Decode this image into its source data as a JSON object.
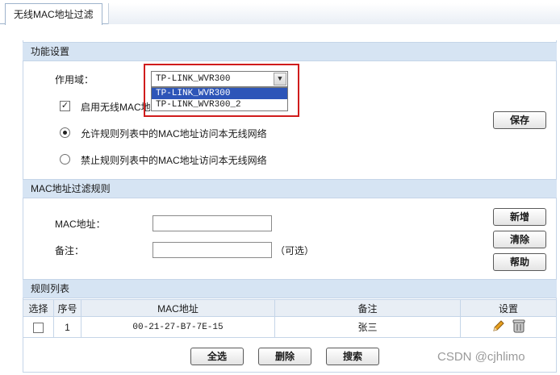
{
  "tab": {
    "title": "无线MAC地址过滤"
  },
  "function_settings": {
    "header": "功能设置",
    "scope_label": "作用域：",
    "scope_selected": "TP-LINK_WVR300",
    "scope_options": [
      "TP-LINK_WVR300",
      "TP-LINK_WVR300_2"
    ],
    "enable_label": "启用无线MAC地址过滤",
    "enable_checked": true,
    "allow_label": "允许规则列表中的MAC地址访问本无线网络",
    "deny_label": "禁止规则列表中的MAC地址访问本无线网络",
    "selected_mode": "allow",
    "save_label": "保存"
  },
  "filter_rules": {
    "header": "MAC地址过滤规则",
    "mac_label": "MAC地址：",
    "mac_value": "",
    "note_label": "备注：",
    "note_value": "",
    "optional_hint": "（可选）",
    "add_label": "新增",
    "clear_label": "清除",
    "help_label": "帮助"
  },
  "rule_list": {
    "header": "规则列表",
    "columns": [
      "选择",
      "序号",
      "MAC地址",
      "备注",
      "设置"
    ],
    "rows": [
      {
        "index": "1",
        "mac": "00-21-27-B7-7E-15",
        "note": "张三",
        "checked": false
      }
    ],
    "select_all_label": "全选",
    "delete_label": "删除",
    "search_label": "搜索"
  },
  "watermark": "CSDN @cjhlimo",
  "colors": {
    "section_header": "#d6e4f3",
    "highlight_box": "#d01c1c",
    "option_selected": "#2d55b8"
  }
}
